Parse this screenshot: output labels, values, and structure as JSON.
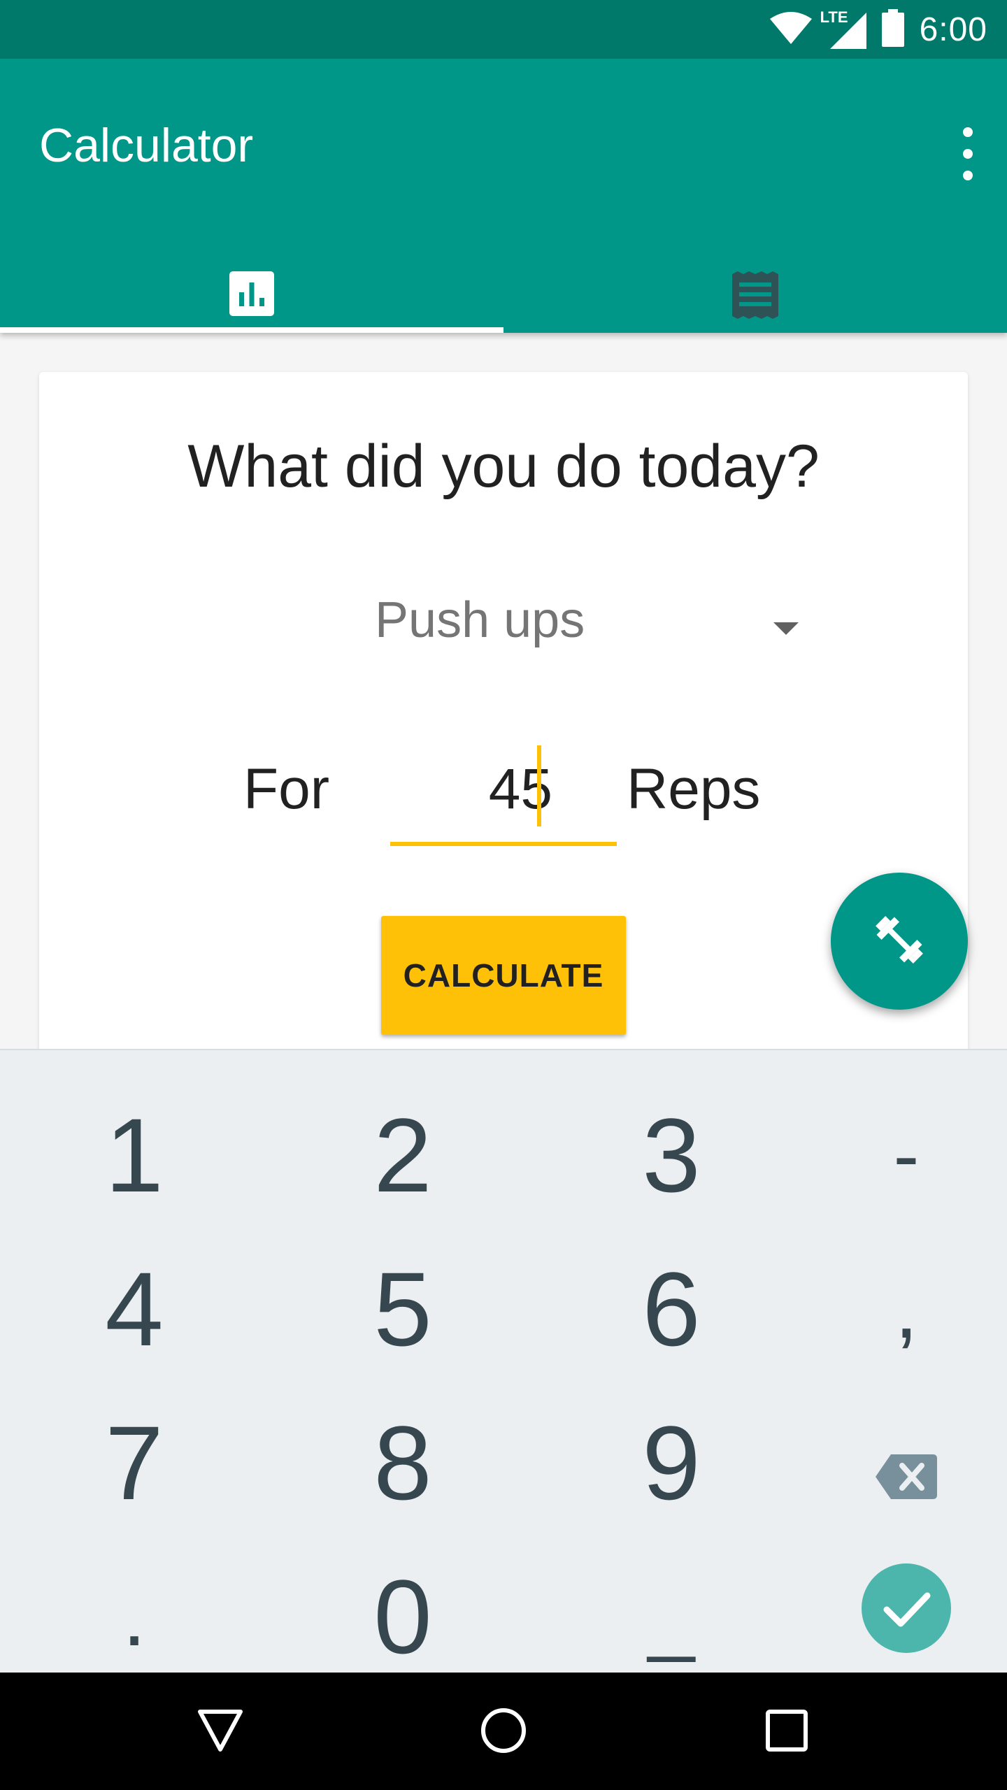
{
  "status_bar": {
    "time": "6:00",
    "network": "LTE",
    "icons": [
      "wifi-icon",
      "signal-icon",
      "battery-icon"
    ]
  },
  "app_bar": {
    "title": "Calculator",
    "overflow_icon": "more-vert-icon",
    "tabs": [
      {
        "icon": "bar-chart-icon",
        "selected": true
      },
      {
        "icon": "list-icon",
        "selected": false
      }
    ]
  },
  "card": {
    "question": "What did you do today?",
    "exercise_select": {
      "selected": "Push ups"
    },
    "for_label": "For",
    "reps_value": "45",
    "reps_label": "Reps",
    "calculate_button": "CALCULATE"
  },
  "fab": {
    "icon": "fitness-dumbbell-icon"
  },
  "keypad": {
    "rows": [
      [
        "1",
        "2",
        "3",
        "-"
      ],
      [
        "4",
        "5",
        "6",
        ","
      ],
      [
        "7",
        "8",
        "9",
        "backspace"
      ],
      [
        ".",
        "0",
        "_",
        "done"
      ]
    ]
  },
  "nav_bar": {
    "icons": [
      "back-icon",
      "home-icon",
      "recents-icon"
    ]
  },
  "colors": {
    "primary": "#009688",
    "primary_dark": "#00796b",
    "accent": "#ffc107",
    "keypad_bg": "#eceff1",
    "key_text": "#37474f",
    "done_key": "#4db6ac"
  }
}
